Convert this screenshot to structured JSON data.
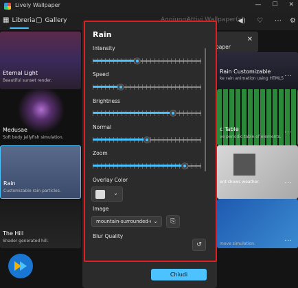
{
  "window": {
    "title": "Lively Wallpaper",
    "min": "—",
    "max": "☐",
    "close": "✕"
  },
  "nav": {
    "library": "Libreria",
    "gallery": "Gallery",
    "add": "Aggiungi",
    "active": "Attivi Wallpaper(s)"
  },
  "cards_left": [
    {
      "title": "Eternal Light",
      "subtitle": "Beautiful sunset render."
    },
    {
      "title": "Medusae",
      "subtitle": "Soft body jellyfish simulation."
    },
    {
      "title": "Rain",
      "subtitle": "Customizable rain particles."
    },
    {
      "title": "The Hill",
      "subtitle": "Shader generated hill."
    }
  ],
  "cards_right": [
    {
      "title": "Rain Customizable",
      "subtitle": "ke rain animation using HTML5"
    },
    {
      "title": "c Table",
      "subtitle": "ve periodic table of elements."
    },
    {
      "title": "",
      "subtitle": "ent shows weather."
    },
    {
      "title": "",
      "subtitle": "move simulation."
    }
  ],
  "more_label": "...",
  "notice": {
    "text": "paper",
    "close": "✕"
  },
  "dialog": {
    "title": "Rain",
    "sliders": [
      {
        "label": "Intensity",
        "value": 0.41
      },
      {
        "label": "Speed",
        "value": 0.26
      },
      {
        "label": "Brightness",
        "value": 0.74
      },
      {
        "label": "Normal",
        "value": 0.5
      },
      {
        "label": "Zoom",
        "value": 0.85
      }
    ],
    "overlay_color_label": "Overlay Color",
    "overlay_color": "#dcdcdc",
    "image_label": "Image",
    "image_value": "mountain-surrounded-w",
    "blur_label": "Blur Quality",
    "close_button": "Chiudi"
  },
  "colors": {
    "accent": "#4cc2ff",
    "highlight": "#e02020"
  }
}
